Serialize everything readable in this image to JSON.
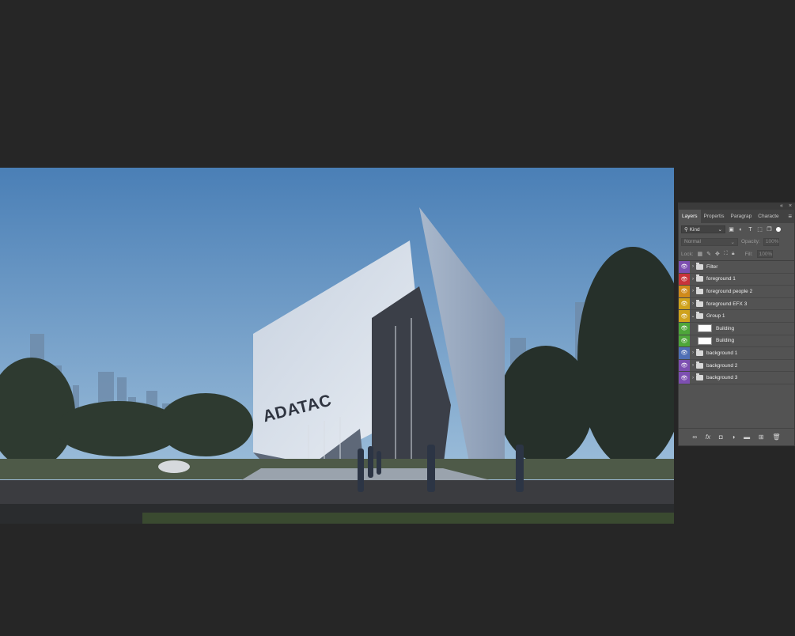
{
  "canvas": {
    "sign_text": "ADATAC",
    "sky_top": "#4a7fb6",
    "sky_bottom": "#a9c7df"
  },
  "panel": {
    "tabs": [
      "Layers",
      "Propertis",
      "Paragrap",
      "Characte"
    ],
    "active_tab": "Layers",
    "filter_kind": "Kind",
    "blend_mode": "Normal",
    "opacity_label": "Opacity:",
    "opacity_value": "100%",
    "lock_label": "Lock:",
    "fill_label": "Fill:",
    "fill_value": "100%",
    "layers": [
      {
        "name": "Filter",
        "color": "#7d4fb1",
        "type": "folder",
        "expanded": false
      },
      {
        "name": "foreground 1",
        "color": "#c8333a",
        "type": "folder",
        "expanded": false
      },
      {
        "name": "foreground people 2",
        "color": "#d08a1a",
        "type": "folder",
        "expanded": false
      },
      {
        "name": "foreground EFX 3",
        "color": "#cfa21d",
        "type": "folder",
        "expanded": false
      },
      {
        "name": "Group 1",
        "color": "#cfa21d",
        "type": "folder",
        "expanded": true
      },
      {
        "name": "Building",
        "color": "#4ea63a",
        "type": "layer",
        "expanded": false
      },
      {
        "name": "Building",
        "color": "#4ea63a",
        "type": "layer",
        "expanded": false
      },
      {
        "name": "background 1",
        "color": "#4f6fb5",
        "type": "folder",
        "expanded": false
      },
      {
        "name": "background 2",
        "color": "#7d4fb1",
        "type": "folder",
        "expanded": false
      },
      {
        "name": "background 3",
        "color": "#7d4fb1",
        "type": "folder",
        "expanded": false
      }
    ]
  }
}
